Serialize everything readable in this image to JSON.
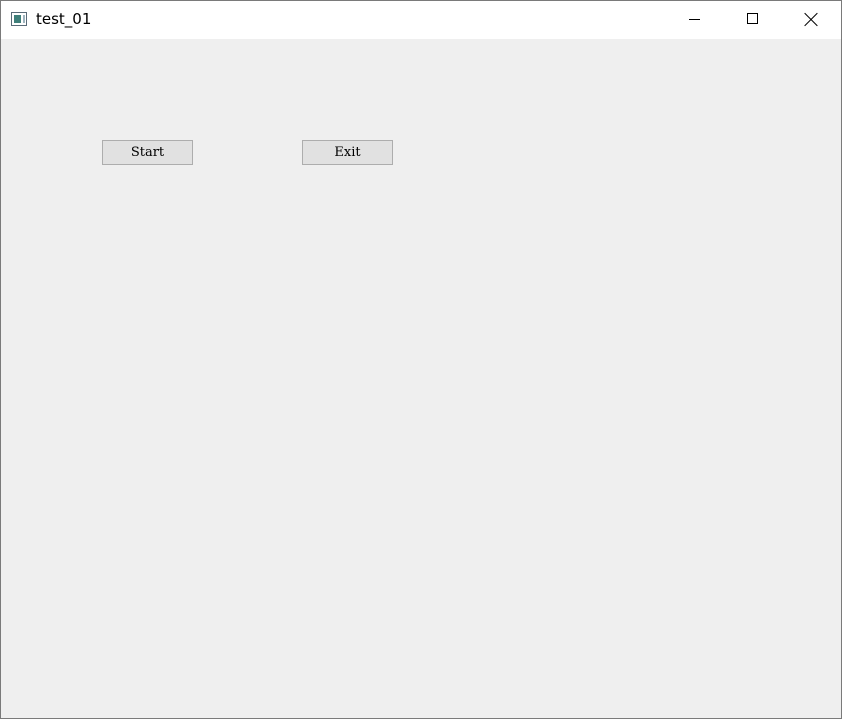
{
  "window": {
    "title": "test_01",
    "icon": "application-window-icon",
    "controls": [
      "minimize-icon",
      "maximize-icon",
      "close-icon"
    ]
  },
  "buttons": {
    "start_label": "Start",
    "exit_label": "Exit"
  },
  "colors": {
    "titlebar": "#ffffff",
    "client_background": "#efefef",
    "button_face": "#e1e1e1",
    "button_border": "#adadad"
  }
}
